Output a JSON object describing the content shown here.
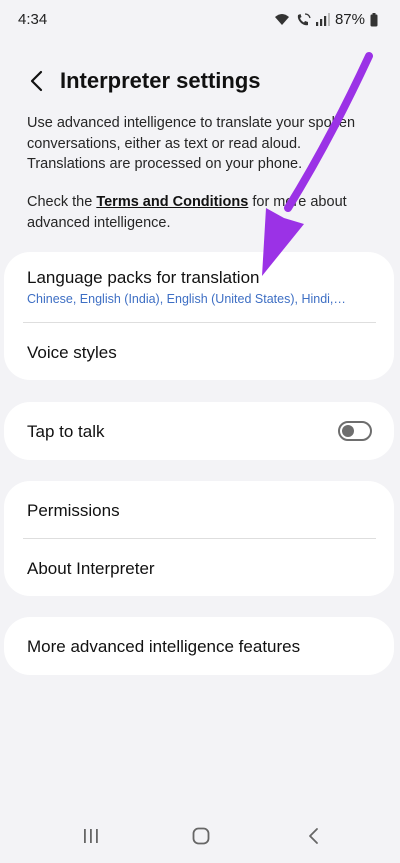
{
  "status_bar": {
    "time": "4:34",
    "battery": "87%"
  },
  "header": {
    "title": "Interpreter settings"
  },
  "description": {
    "paragraph1": "Use advanced intelligence to translate your spoken conversations, either as text or read aloud. Translations are processed on your phone.",
    "check_prefix": "Check the ",
    "terms_link": "Terms and Conditions",
    "check_suffix": " for more about advanced intelligence."
  },
  "settings": {
    "language_packs": {
      "title": "Language packs for translation",
      "subtitle": "Chinese, English (India), English (United States), Hindi,…"
    },
    "voice_styles": {
      "title": "Voice styles"
    },
    "tap_to_talk": {
      "title": "Tap to talk",
      "enabled": false
    },
    "permissions": {
      "title": "Permissions"
    },
    "about": {
      "title": "About Interpreter"
    },
    "more_features": {
      "title": "More advanced intelligence features"
    }
  },
  "colors": {
    "background": "#f3f3f6",
    "card": "#ffffff",
    "subtitle_blue": "#3e6fc4",
    "arrow_purple": "#9b32e6"
  }
}
